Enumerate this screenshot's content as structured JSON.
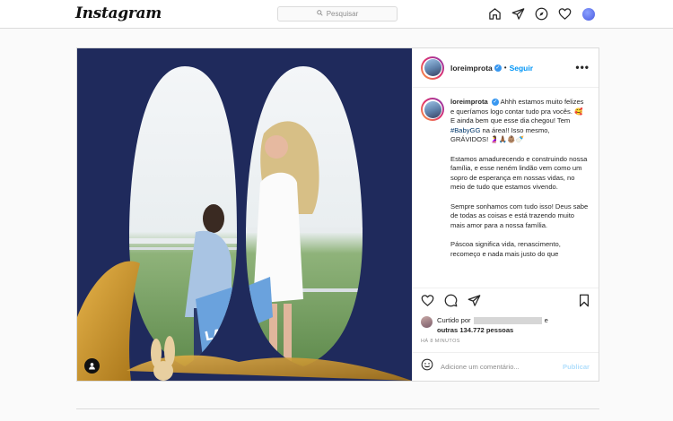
{
  "app": {
    "logo": "Instagram"
  },
  "search": {
    "placeholder": "Pesquisar"
  },
  "nav": {
    "icons": [
      "home-icon",
      "direct-icon",
      "explore-icon",
      "activity-heart-icon",
      "profile-avatar"
    ]
  },
  "post": {
    "username": "loreimprota",
    "separator": "•",
    "follow_label": "Seguir",
    "more_label": "•••",
    "caption": {
      "p1_rest": " Ahhh estamos muito felizes e queríamos logo contar tudo pra vocês. 🥰 E ainda bem que esse dia chegou! Tem ",
      "hashtag": "#BabyGG",
      "p1_end": " na área!! Isso mesmo, GRÁVIDOS! 🤰🙏🏾👶🏽🍼",
      "p2": "Estamos amadurecendo e construindo nossa família, e esse neném lindão vem como um sopro de esperança em nossas vidas, no meio de tudo que estamos vivendo.",
      "p3": "Sempre sonhamos com tudo isso! Deus sabe de todas as coisas e está trazendo muito mais amor para a nossa família.",
      "p4": "Páscoa significa vida, renascimento, recomeço e nada mais justo do que"
    },
    "likes": {
      "prefix": "Curtido por",
      "and": "e",
      "others": "outras 134.772 pessoas"
    },
    "time": "HÁ 8 MINUTOS",
    "comment_placeholder": "Adicione um comentário...",
    "publish_label": "Publicar"
  },
  "colors": {
    "brand_blue": "#0095f6",
    "verified": "#3897f0",
    "photo_bg": "#1f2a5c",
    "gold": "#c8962a"
  }
}
